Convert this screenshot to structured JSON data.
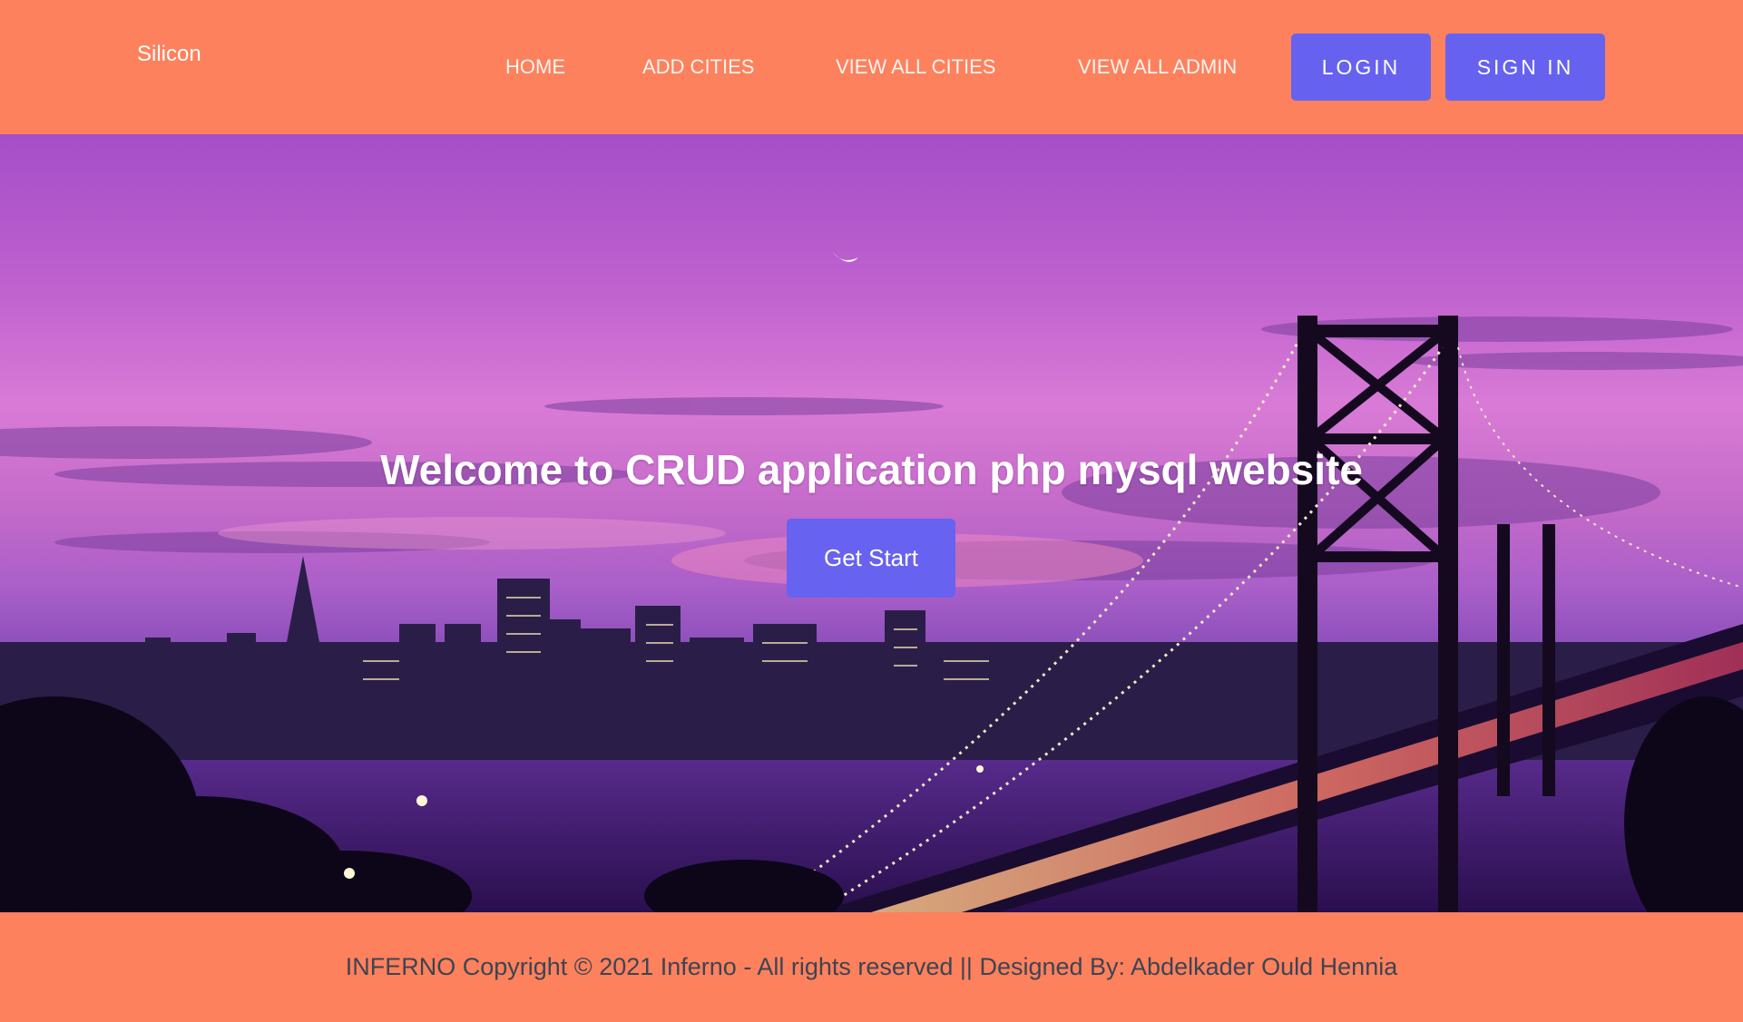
{
  "header": {
    "brand": "Silicon",
    "nav": [
      "HOME",
      "ADD CITIES",
      "VIEW ALL CITIES",
      "VIEW ALL ADMIN"
    ],
    "login_label": "LOGIN",
    "signin_label": "SIGN IN"
  },
  "hero": {
    "title": "Welcome to CRUD application php mysql website",
    "cta_label": "Get Start",
    "image_subject": "city skyline with suspension bridge at dusk"
  },
  "footer": {
    "copyright": "INFERNO Copyright © 2021 Inferno - All rights reserved || Designed By: Abdelkader Ould Hennia"
  },
  "colors": {
    "bar_background": "#fd815d",
    "button": "#6662ef",
    "footer_text": "#3e4452"
  },
  "icons": [
    "moon-icon"
  ]
}
